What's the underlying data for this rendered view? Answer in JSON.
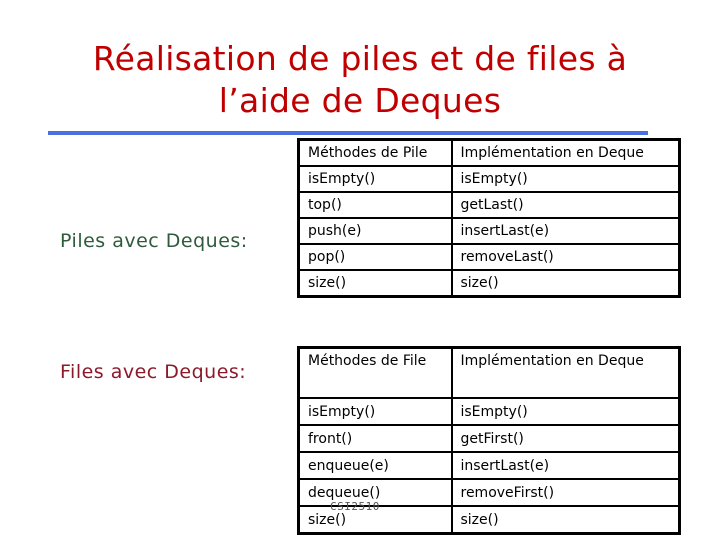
{
  "slide": {
    "title_line1": "Réalisation de piles et de files à",
    "title_line2": "l’aide de Deques",
    "accent_color": "#c00000",
    "rule_color": "#4a6fe0"
  },
  "piles": {
    "label": "Piles avec Deques:",
    "label_color": "#2e5b3c",
    "headers": [
      "Méthodes de Pile",
      "Implémentation en Deque"
    ],
    "rows": [
      [
        "isEmpty()",
        "isEmpty()"
      ],
      [
        "top()",
        "getLast()"
      ],
      [
        "push(e)",
        "insertLast(e)"
      ],
      [
        "pop()",
        "removeLast()"
      ],
      [
        "size()",
        "size()"
      ]
    ]
  },
  "files": {
    "label": "Files avec Deques:",
    "label_color": "#8b1a2b",
    "headers": [
      "Méthodes de File",
      "Implémentation en Deque"
    ],
    "rows": [
      [
        "isEmpty()",
        "isEmpty()"
      ],
      [
        "front()",
        "getFirst()"
      ],
      [
        "enqueue(e)",
        "insertLast(e)"
      ],
      [
        "dequeue()",
        "removeFirst()"
      ],
      [
        "size()",
        "size()"
      ]
    ]
  },
  "footer": {
    "watermark": "CSI2510"
  }
}
